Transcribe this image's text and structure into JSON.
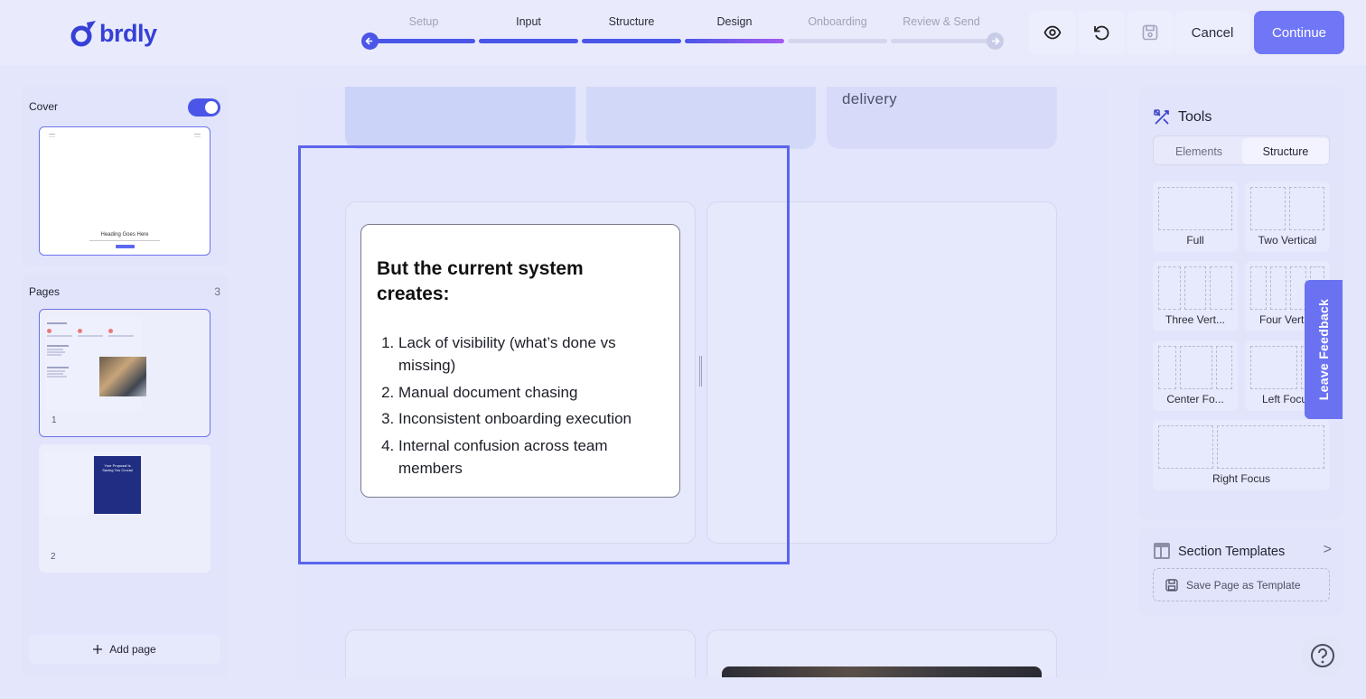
{
  "header": {
    "logo_text": "brdly",
    "steps": [
      {
        "label": "Setup",
        "state": "done"
      },
      {
        "label": "Input",
        "state": "done"
      },
      {
        "label": "Structure",
        "state": "done"
      },
      {
        "label": "Design",
        "state": "current"
      },
      {
        "label": "Onboarding",
        "state": "todo"
      },
      {
        "label": "Review & Send",
        "state": "todo"
      }
    ],
    "cancel_label": "Cancel",
    "continue_label": "Continue"
  },
  "sidebar": {
    "cover_label": "Cover",
    "cover_enabled": true,
    "cover_thumb_heading": "Heading Goes Here",
    "pages_label": "Pages",
    "pages_count": "3",
    "pages": [
      {
        "number": "1",
        "selected": true
      },
      {
        "number": "2",
        "selected": false
      }
    ],
    "page2_thumb_title": "Your Proposal Is Saving You Crucial",
    "add_page_label": "Add page"
  },
  "canvas": {
    "top_card_text": "delivery",
    "heading": "But the current system creates:",
    "list_items": [
      "Lack of visibility (what’s done vs missing)",
      "Manual document chasing",
      "Inconsistent onboarding execution",
      "Internal confusion across team members"
    ]
  },
  "tools": {
    "title": "Tools",
    "tabs": [
      {
        "label": "Elements",
        "active": false
      },
      {
        "label": "Structure",
        "active": true
      }
    ],
    "layouts": [
      "Full",
      "Two Vertical",
      "Three Vert...",
      "Four Verti...",
      "Center Fo...",
      "Left Focus",
      "Right Focus"
    ]
  },
  "templates": {
    "title": "Section Templates",
    "arrow": ">",
    "save_label": "Save Page as Template"
  },
  "feedback_label": "Leave Feedback",
  "colors": {
    "accent": "#4b56e8",
    "continue_bg": "#7077f7",
    "feedback_bg": "#6a72f2"
  }
}
